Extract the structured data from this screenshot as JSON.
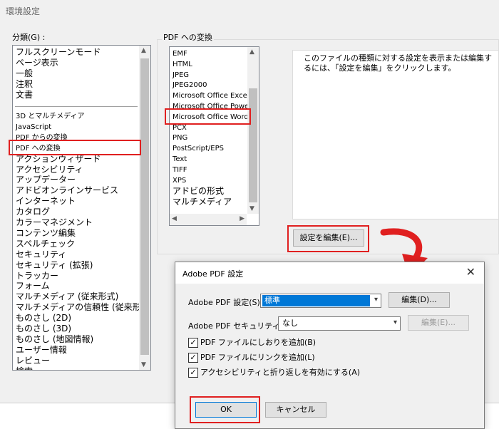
{
  "window": {
    "title": "環境設定"
  },
  "categories": {
    "label": "分類(G) :",
    "top_items": [
      "フルスクリーンモード",
      "ページ表示",
      "一般",
      "注釈",
      "文書"
    ],
    "items": [
      {
        "label": "3D とマルチメディア",
        "small": true
      },
      {
        "label": "JavaScript",
        "small": true
      },
      {
        "label": "PDF からの変換",
        "small": true
      },
      {
        "label": "PDF への変換",
        "small": true,
        "selected": true
      },
      {
        "label": "アクションウィザード"
      },
      {
        "label": "アクセシビリティ"
      },
      {
        "label": "アップデーター"
      },
      {
        "label": "アドビオンラインサービス"
      },
      {
        "label": "インターネット"
      },
      {
        "label": "カタログ"
      },
      {
        "label": "カラーマネジメント"
      },
      {
        "label": "コンテンツ編集"
      },
      {
        "label": "スペルチェック"
      },
      {
        "label": "セキュリティ"
      },
      {
        "label": "セキュリティ (拡張)"
      },
      {
        "label": "トラッカー"
      },
      {
        "label": "フォーム"
      },
      {
        "label": "マルチメディア (従来形式)"
      },
      {
        "label": "マルチメディアの信頼性 (従来形式)"
      },
      {
        "label": "ものさし (2D)"
      },
      {
        "label": "ものさし (3D)"
      },
      {
        "label": "ものさし (地図情報)"
      },
      {
        "label": "ユーザー情報"
      },
      {
        "label": "レビュー"
      },
      {
        "label": "検索"
      }
    ]
  },
  "convert": {
    "group_title": "PDF への変換",
    "formats": [
      {
        "label": "EMF"
      },
      {
        "label": "HTML"
      },
      {
        "label": "JPEG"
      },
      {
        "label": "JPEG2000"
      },
      {
        "label": "Microsoft Office Excel"
      },
      {
        "label": "Microsoft Office PowerPoint"
      },
      {
        "label": "Microsoft Office Word",
        "selected": true
      },
      {
        "label": "PCX"
      },
      {
        "label": "PNG"
      },
      {
        "label": "PostScript/EPS"
      },
      {
        "label": "Text"
      },
      {
        "label": "TIFF"
      },
      {
        "label": "XPS"
      },
      {
        "label": "アドビの形式",
        "large": true
      },
      {
        "label": "マルチメディア",
        "large": true
      }
    ],
    "description": "このファイルの種類に対する設定を表示または編集するには、「設定を編集」をクリックします。",
    "edit_settings_button": "設定を編集(E)..."
  },
  "dialog": {
    "title": "Adobe PDF 設定",
    "settings_label": "Adobe PDF 設定(S) :",
    "settings_value": "標準",
    "edit_button": "編集(D)...",
    "security_label": "Adobe PDF セキュリティ(C) :",
    "security_value": "なし",
    "security_edit_button": "編集(E)...",
    "checkboxes": [
      {
        "label": "PDF ファイルにしおりを追加(B)",
        "checked": true
      },
      {
        "label": "PDF ファイルにリンクを追加(L)",
        "checked": true
      },
      {
        "label": "アクセシビリティと折り返しを有効にする(A)",
        "checked": true
      }
    ],
    "ok_button": "OK",
    "cancel_button": "キャンセル"
  },
  "icons": {
    "close": "close-icon",
    "dropdown": "chevron-down-icon",
    "checkmark": "checkmark-icon",
    "callout_arrow": "curved-arrow-icon"
  },
  "colors": {
    "highlight_box": "#e02020",
    "selection": "#0078d7"
  }
}
